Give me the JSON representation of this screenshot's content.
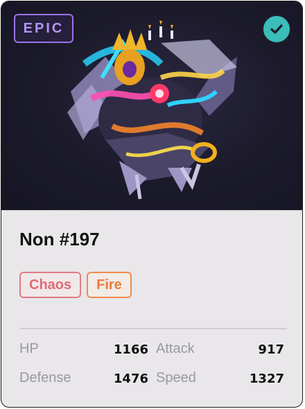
{
  "card": {
    "rarity": "EPIC",
    "name": "Non #197",
    "tags": [
      "Chaos",
      "Fire"
    ],
    "stats": [
      {
        "label": "HP",
        "value": "1166"
      },
      {
        "label": "Attack",
        "value": "917"
      },
      {
        "label": "Defense",
        "value": "1476"
      },
      {
        "label": "Speed",
        "value": "1327"
      }
    ]
  },
  "icons": {
    "verified": "check-circle-icon",
    "artwork": "creature-artwork"
  },
  "colors": {
    "art_background": "#1b1a2a",
    "rarity_accent": "#9a73e6",
    "verified_badge": "#3bbdb9",
    "tag_chaos": "#e07a82",
    "tag_fire": "#f08a4c",
    "card_body": "#e9e7ea"
  }
}
